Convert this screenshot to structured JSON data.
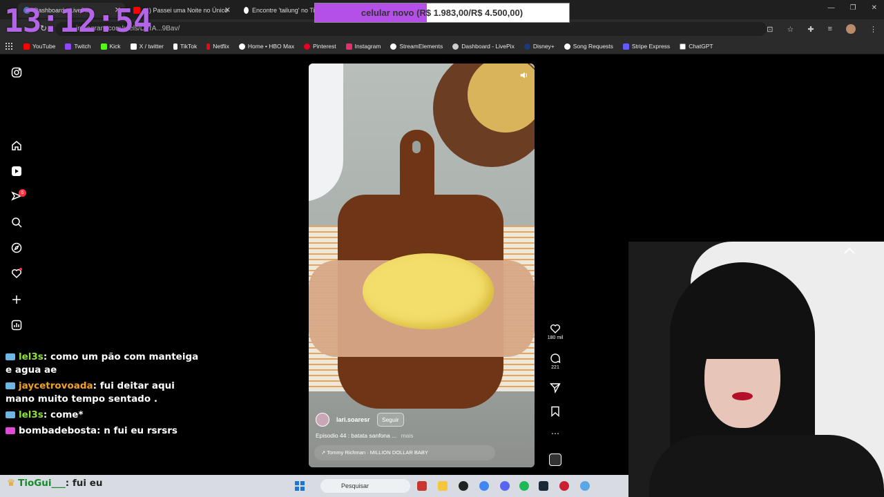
{
  "browser": {
    "tabs": [
      {
        "label": "Dashboard - LivePix",
        "color": "#4a90e2"
      },
      {
        "label": "(1) Passei uma Noite no Único",
        "color": "#ff0000"
      },
      {
        "label": "Encontre 'tailung' no TikTok",
        "color": "#ffffff"
      }
    ],
    "url": "instagram.com/reels/DVrA...9Bav/",
    "bookmarks": [
      {
        "label": "YouTube",
        "color": "#ff0000"
      },
      {
        "label": "Twitch",
        "color": "#9146ff"
      },
      {
        "label": "Kick",
        "color": "#53fc18"
      },
      {
        "label": "X / twitter",
        "color": "#ffffff"
      },
      {
        "label": "TikTok",
        "color": "#ffffff"
      },
      {
        "label": "Netflix",
        "color": "#e50914"
      },
      {
        "label": "Home • HBO Max",
        "color": "#ffffff"
      },
      {
        "label": "Pinterest",
        "color": "#e60023"
      },
      {
        "label": "Instagram",
        "color": "#e1306c"
      },
      {
        "label": "StreamElements",
        "color": "#ffffff"
      },
      {
        "label": "Dashboard - LivePix",
        "color": "#cccccc"
      },
      {
        "label": "Disney+",
        "color": "#1c3a7a"
      },
      {
        "label": "Song Requests",
        "color": "#ffffff"
      },
      {
        "label": "Stripe Express",
        "color": "#635bff"
      },
      {
        "label": "ChatGPT",
        "color": "#ffffff"
      }
    ]
  },
  "overlay": {
    "clock": "13:12:54",
    "goal_text": "celular novo (R$ 1.983,00/R$ 4.500,00)",
    "goal_progress": 0.44,
    "goal_color": "#b44fe8",
    "clock_color": "#b266e6"
  },
  "sidebar": {
    "notifications_badge": "6",
    "icons": [
      "instagram-icon",
      "home-icon",
      "reels-icon",
      "messages-icon",
      "search-icon",
      "explore-icon",
      "heart-icon",
      "create-icon",
      "dashboard-icon"
    ]
  },
  "reel": {
    "username": "lari.soaresr",
    "follow_label": "Seguir",
    "caption": "Episodio 44 : batata sanfona ...",
    "caption_more": "mais",
    "audio": "↗ Tommy Richman · MILLION DOLLAR BABY",
    "likes": "180 mil",
    "comments": "221"
  },
  "chat": [
    {
      "user": "lel3s",
      "text": "como um pão com manteiga e agua ae",
      "user_color": "#8de23a"
    },
    {
      "user": "jaycetrovoada",
      "text": "fui deitar aqui mano muito tempo sentado .",
      "user_color": "#f0a12a"
    },
    {
      "user": "lel3s",
      "text": "come*",
      "user_color": "#8de23a"
    },
    {
      "user": "bombadebosta",
      "text": "n fui eu rsrsrs",
      "user_color": "#ffffff"
    }
  ],
  "taskbar_chat": {
    "user": "TioGui___",
    "text": "fui eu"
  },
  "taskbar": {
    "search_placeholder": "Pesquisar"
  }
}
